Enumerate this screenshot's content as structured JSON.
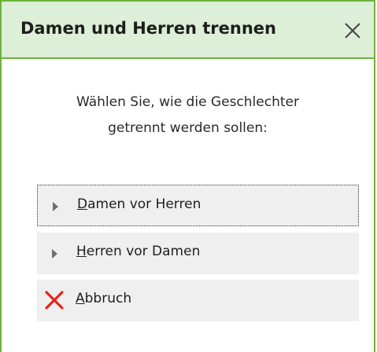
{
  "dialog": {
    "title": "Damen und Herren trennen",
    "close_icon": "close-icon",
    "message_line1": "Wählen Sie, wie die Geschlechter",
    "message_line2": "getrennt werden sollen:"
  },
  "options": [
    {
      "mnemonic": "D",
      "rest": "amen vor Herren",
      "icon": "triangle-right-icon",
      "focused": true
    },
    {
      "mnemonic": "H",
      "rest": "erren vor Damen",
      "icon": "triangle-right-icon",
      "focused": false
    },
    {
      "mnemonic": "A",
      "rest": "bbruch",
      "icon": "red-x-icon",
      "focused": false
    }
  ],
  "colors": {
    "accent_green": "#6cb33e",
    "titlebar_bg": "#ddefd7",
    "option_bg": "#efefef",
    "cancel_red": "#e2261a"
  }
}
